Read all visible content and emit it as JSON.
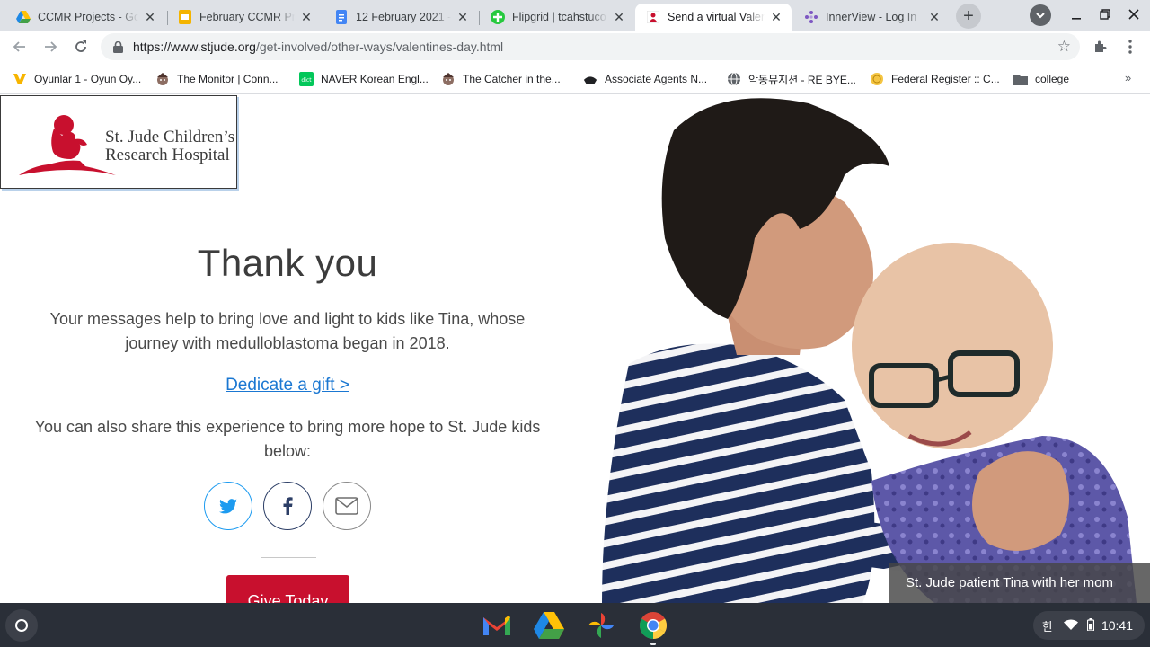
{
  "browser": {
    "tabs": [
      {
        "title": "CCMR Projects - Go",
        "favicon": "google-drive-icon"
      },
      {
        "title": "February CCMR Pro",
        "favicon": "google-slides-icon"
      },
      {
        "title": "12 February 2021 -",
        "favicon": "google-docs-icon"
      },
      {
        "title": "Flipgrid | tcahstuco",
        "favicon": "flipgrid-icon"
      },
      {
        "title": "Send a virtual Valen",
        "favicon": "stjude-icon",
        "active": true
      },
      {
        "title": "InnerView - Log In",
        "favicon": "innerview-icon"
      }
    ],
    "new_tab_symbol": "+",
    "close_symbol": "✕",
    "url_host": "https://www.stjude.org",
    "url_path": "/get-involved/other-ways/valentines-day.html"
  },
  "bookmarks": [
    {
      "label": "Oyunlar 1 - Oyun Oy...",
      "icon": "oyunlar-icon"
    },
    {
      "label": "The Monitor | Conn...",
      "icon": "the-monitor-icon"
    },
    {
      "label": "NAVER Korean Engl...",
      "icon": "naver-dict-icon"
    },
    {
      "label": "The Catcher in the...",
      "icon": "catcher-icon"
    },
    {
      "label": "Associate Agents N...",
      "icon": "associate-agents-icon"
    },
    {
      "label": "악동뮤지션 - RE BYE...",
      "icon": "globe-icon"
    },
    {
      "label": "Federal Register :: C...",
      "icon": "federal-register-icon"
    },
    {
      "label": "college",
      "icon": "folder-icon"
    }
  ],
  "bookmarks_more": "»",
  "page": {
    "logo_line1": "St. Jude Children’s",
    "logo_line2": "Research Hospital",
    "heading": "Thank you",
    "message_line1": "Your messages help to bring love and light to kids like Tina, whose",
    "message_line2": "journey with medulloblastoma began in 2018.",
    "dedicate_link": "Dedicate a gift >",
    "share_line1": "You can also share this experience to bring more hope to St. Jude kids",
    "share_line2": "below:",
    "give_button": "Give Today",
    "photo_caption": "St. Jude patient Tina with her mom"
  },
  "os": {
    "ime_indicator": "한",
    "clock": "10:41"
  },
  "colors": {
    "brand_red": "#c8102e",
    "link_blue": "#1a77d2",
    "twitter_blue": "#1d9bf0",
    "facebook_navy": "#2c3e66"
  }
}
